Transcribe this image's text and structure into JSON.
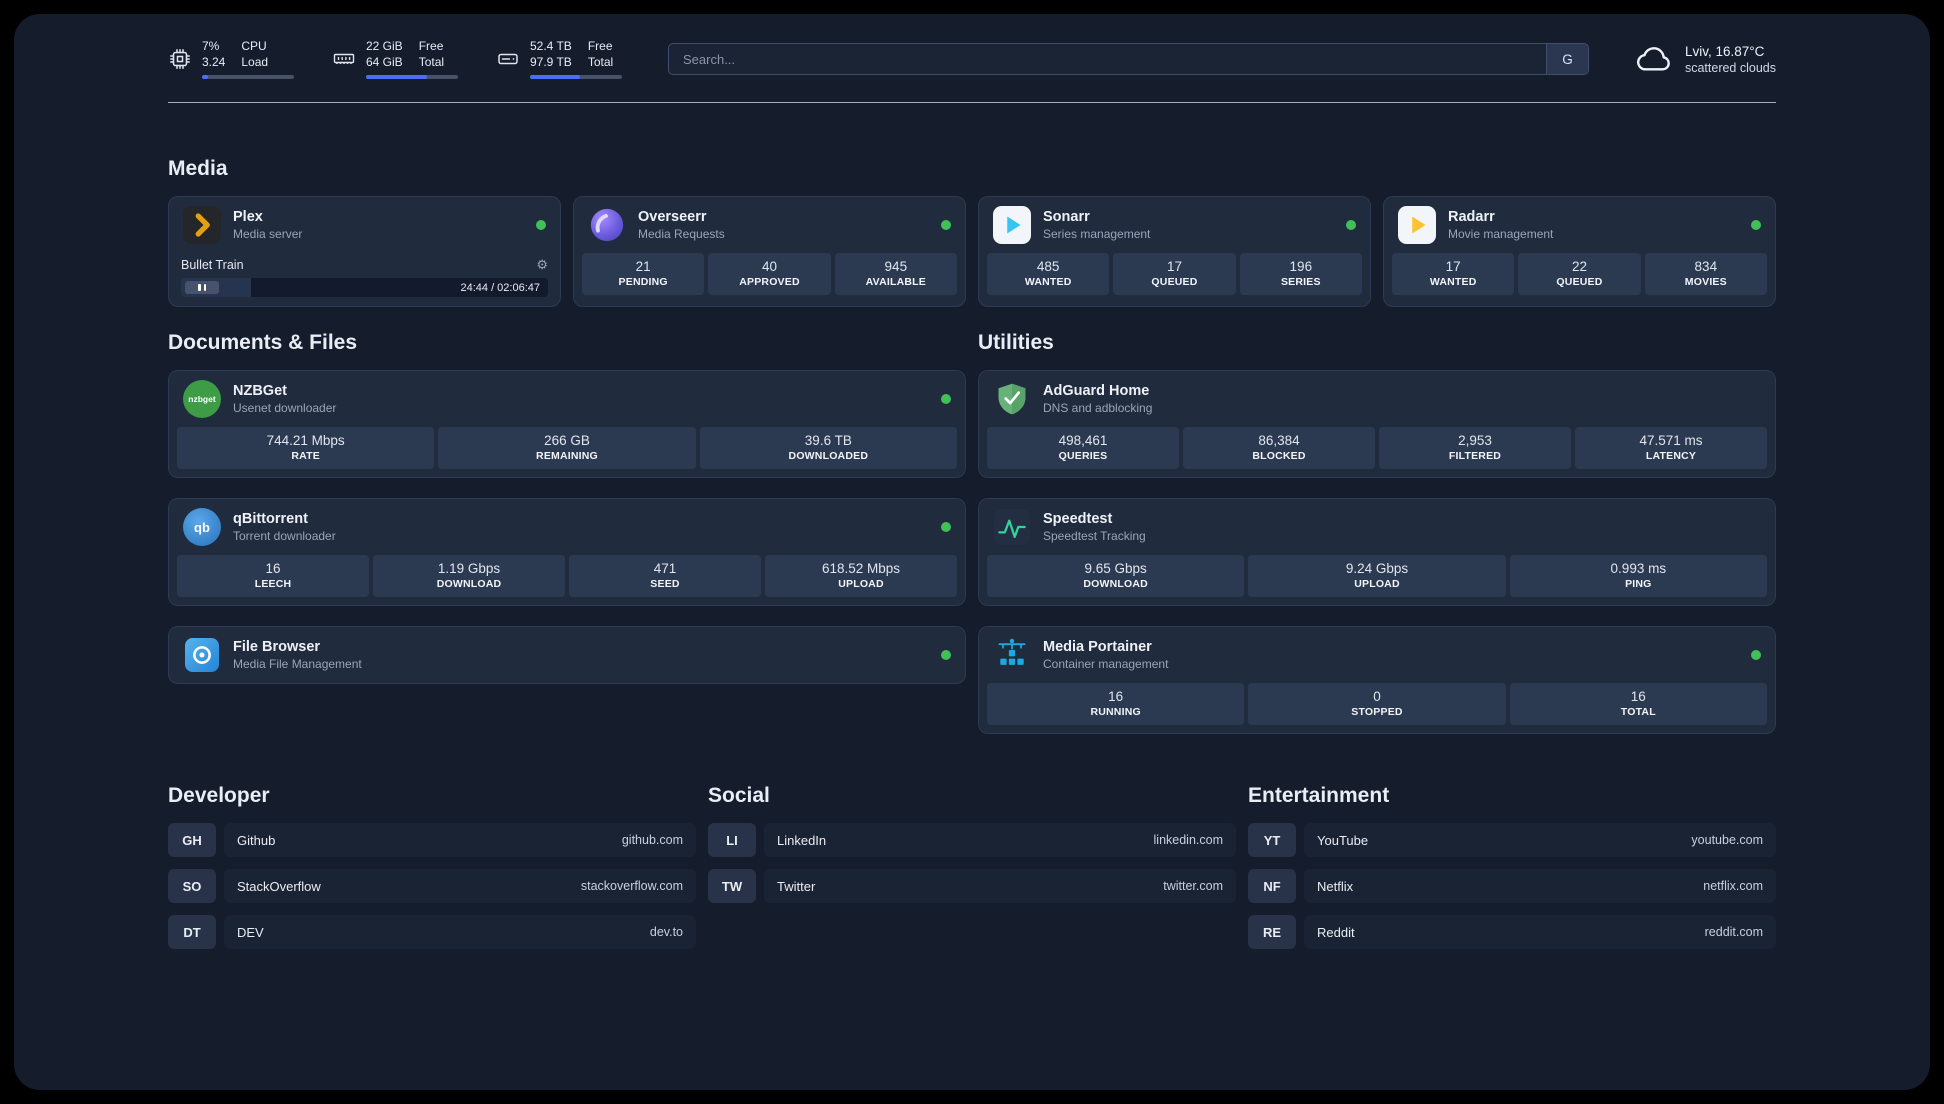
{
  "colors": {
    "background": "#151c2b",
    "card": "#202b3d",
    "stat_tile": "#2c3a51",
    "accent_blue": "#4f6ef7",
    "online_green": "#40c057"
  },
  "icons": {
    "settings_glyph": "⚙",
    "cpu": "cpu-chip-icon",
    "memory": "memory-icon",
    "storage": "hard-drive-icon",
    "weather": "cloud-icon"
  },
  "topbar": {
    "cpu": {
      "value_top": "7%",
      "value_bottom": "3.24",
      "label_top": "CPU",
      "label_bottom": "Load",
      "progress": 7
    },
    "ram": {
      "value_top": "22 GiB",
      "value_bottom": "64 GiB",
      "label_top": "Free",
      "label_bottom": "Total",
      "progress": 66
    },
    "disk": {
      "value_top": "52.4 TB",
      "value_bottom": "97.9 TB",
      "label_top": "Free",
      "label_bottom": "Total",
      "progress": 54
    },
    "search": {
      "placeholder": "Search...",
      "engine_label": "G"
    },
    "weather": {
      "location": "Lviv, 16.87°C",
      "condition": "scattered clouds"
    }
  },
  "sections": {
    "media": {
      "title": "Media"
    },
    "documents": {
      "title": "Documents & Files"
    },
    "utilities": {
      "title": "Utilities"
    },
    "developer": {
      "title": "Developer"
    },
    "social": {
      "title": "Social"
    },
    "entertainment": {
      "title": "Entertainment"
    }
  },
  "apps": {
    "plex": {
      "name": "Plex",
      "desc": "Media server",
      "player": {
        "title": "Bullet Train",
        "time": "24:44 / 02:06:47",
        "progress": 19
      }
    },
    "overseerr": {
      "name": "Overseerr",
      "desc": "Media Requests",
      "stats": [
        {
          "value": "21",
          "label": "PENDING"
        },
        {
          "value": "40",
          "label": "APPROVED"
        },
        {
          "value": "945",
          "label": "AVAILABLE"
        }
      ]
    },
    "sonarr": {
      "name": "Sonarr",
      "desc": "Series management",
      "stats": [
        {
          "value": "485",
          "label": "WANTED"
        },
        {
          "value": "17",
          "label": "QUEUED"
        },
        {
          "value": "196",
          "label": "SERIES"
        }
      ]
    },
    "radarr": {
      "name": "Radarr",
      "desc": "Movie management",
      "stats": [
        {
          "value": "17",
          "label": "WANTED"
        },
        {
          "value": "22",
          "label": "QUEUED"
        },
        {
          "value": "834",
          "label": "MOVIES"
        }
      ]
    },
    "nzbget": {
      "name": "NZBGet",
      "desc": "Usenet downloader",
      "icon_text": "nzbget",
      "stats": [
        {
          "value": "744.21 Mbps",
          "label": "RATE"
        },
        {
          "value": "266 GB",
          "label": "REMAINING"
        },
        {
          "value": "39.6 TB",
          "label": "DOWNLOADED"
        }
      ]
    },
    "qbittorrent": {
      "name": "qBittorrent",
      "desc": "Torrent downloader",
      "icon_text": "qb",
      "stats": [
        {
          "value": "16",
          "label": "LEECH"
        },
        {
          "value": "1.19 Gbps",
          "label": "DOWNLOAD"
        },
        {
          "value": "471",
          "label": "SEED"
        },
        {
          "value": "618.52 Mbps",
          "label": "UPLOAD"
        }
      ]
    },
    "filebrowser": {
      "name": "File Browser",
      "desc": "Media File Management"
    },
    "adguard": {
      "name": "AdGuard Home",
      "desc": "DNS and adblocking",
      "stats": [
        {
          "value": "498,461",
          "label": "QUERIES"
        },
        {
          "value": "86,384",
          "label": "BLOCKED"
        },
        {
          "value": "2,953",
          "label": "FILTERED"
        },
        {
          "value": "47.571 ms",
          "label": "LATENCY"
        }
      ]
    },
    "speedtest": {
      "name": "Speedtest",
      "desc": "Speedtest Tracking",
      "stats": [
        {
          "value": "9.65 Gbps",
          "label": "DOWNLOAD"
        },
        {
          "value": "9.24 Gbps",
          "label": "UPLOAD"
        },
        {
          "value": "0.993 ms",
          "label": "PING"
        }
      ]
    },
    "portainer": {
      "name": "Media Portainer",
      "desc": "Container management",
      "stats": [
        {
          "value": "16",
          "label": "RUNNING"
        },
        {
          "value": "0",
          "label": "STOPPED"
        },
        {
          "value": "16",
          "label": "TOTAL"
        }
      ]
    }
  },
  "bookmarks": {
    "developer": [
      {
        "abbr": "GH",
        "name": "Github",
        "url": "github.com"
      },
      {
        "abbr": "SO",
        "name": "StackOverflow",
        "url": "stackoverflow.com"
      },
      {
        "abbr": "DT",
        "name": "DEV",
        "url": "dev.to"
      }
    ],
    "social": [
      {
        "abbr": "LI",
        "name": "LinkedIn",
        "url": "linkedin.com"
      },
      {
        "abbr": "TW",
        "name": "Twitter",
        "url": "twitter.com"
      }
    ],
    "entertainment": [
      {
        "abbr": "YT",
        "name": "YouTube",
        "url": "youtube.com"
      },
      {
        "abbr": "NF",
        "name": "Netflix",
        "url": "netflix.com"
      },
      {
        "abbr": "RE",
        "name": "Reddit",
        "url": "reddit.com"
      }
    ]
  }
}
